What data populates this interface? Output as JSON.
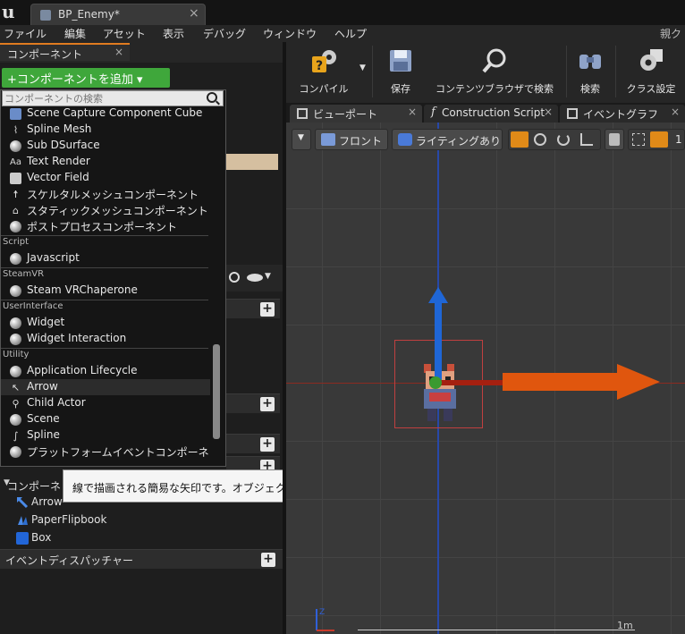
{
  "title_bar": {
    "doc_tab": "BP_Enemy*",
    "close": "×"
  },
  "menu": {
    "items": [
      "ファイル",
      "編集",
      "アセット",
      "表示",
      "デバッグ",
      "ウィンドウ",
      "ヘルプ"
    ],
    "right_text": "親ク"
  },
  "components_panel": {
    "tab_label": "コンポーネント",
    "close": "×",
    "add_button": "+コンポーネントを追加 ▾",
    "search_placeholder": "コンポーネントの検索"
  },
  "dropdown": {
    "items_top": [
      {
        "label": "Scene Capture Component Cube",
        "icon": "cube-capture-icon"
      },
      {
        "label": "Spline Mesh",
        "icon": "spline-mesh-icon"
      },
      {
        "label": "Sub DSurface",
        "icon": "sphere-icon"
      },
      {
        "label": "Text Render",
        "icon": "text-icon"
      },
      {
        "label": "Vector Field",
        "icon": "vector-field-icon"
      },
      {
        "label": "スケルタルメッシュコンポーネント",
        "icon": "skeletal-mesh-icon"
      },
      {
        "label": "スタティックメッシュコンポーネント",
        "icon": "static-mesh-icon"
      },
      {
        "label": "ポストプロセスコンポーネント",
        "icon": "sphere-icon"
      }
    ],
    "cat_script": "Script",
    "script_items": [
      {
        "label": "Javascript",
        "icon": "sphere-icon"
      }
    ],
    "cat_steamvr": "SteamVR",
    "steamvr_items": [
      {
        "label": "Steam VRChaperone",
        "icon": "sphere-icon"
      }
    ],
    "cat_ui": "UserInterface",
    "ui_items": [
      {
        "label": "Widget",
        "icon": "sphere-icon"
      },
      {
        "label": "Widget Interaction",
        "icon": "sphere-icon"
      }
    ],
    "cat_utility": "Utility",
    "utility_items": [
      {
        "label": "Application Lifecycle",
        "icon": "sphere-icon"
      },
      {
        "label": "Arrow",
        "icon": "arrow-icon"
      },
      {
        "label": "Child Actor",
        "icon": "child-actor-icon"
      },
      {
        "label": "Scene",
        "icon": "sphere-icon"
      },
      {
        "label": "Spline",
        "icon": "spline-icon"
      },
      {
        "label": "プラットフォームイベントコンポーネ",
        "icon": "sphere-icon"
      }
    ]
  },
  "tooltip": "線で描画される簡易な矢印です。オブジェクトが対面している方向を示すのに便利です。",
  "tree": {
    "header": "コンポーネ",
    "items": [
      {
        "label": "Arrow",
        "icon": "arrow-icon"
      },
      {
        "label": "PaperFlipbook",
        "icon": "flipbook-icon"
      },
      {
        "label": "Box",
        "icon": "box-icon"
      }
    ]
  },
  "event_dispatcher": "イベントディスパッチャー",
  "toolbar": {
    "compile": "コンパイル",
    "save": "保存",
    "content_browser": "コンテンツブラウザで検索",
    "search": "検索",
    "class_settings": "クラス設定"
  },
  "tabs": {
    "viewport": "ビューポート",
    "construction": "Construction Script",
    "event_graph": "イベントグラフ"
  },
  "viewport": {
    "front": "フロント",
    "lighting": "ライティングあり",
    "scale_text": "1m",
    "grid_value": "1",
    "gizmo_z": "Z"
  },
  "colors": {
    "accent": "#e07b20",
    "add_green": "#3fa73b",
    "arrow_orange": "#e0560e",
    "axis_blue": "#1f66d6"
  }
}
